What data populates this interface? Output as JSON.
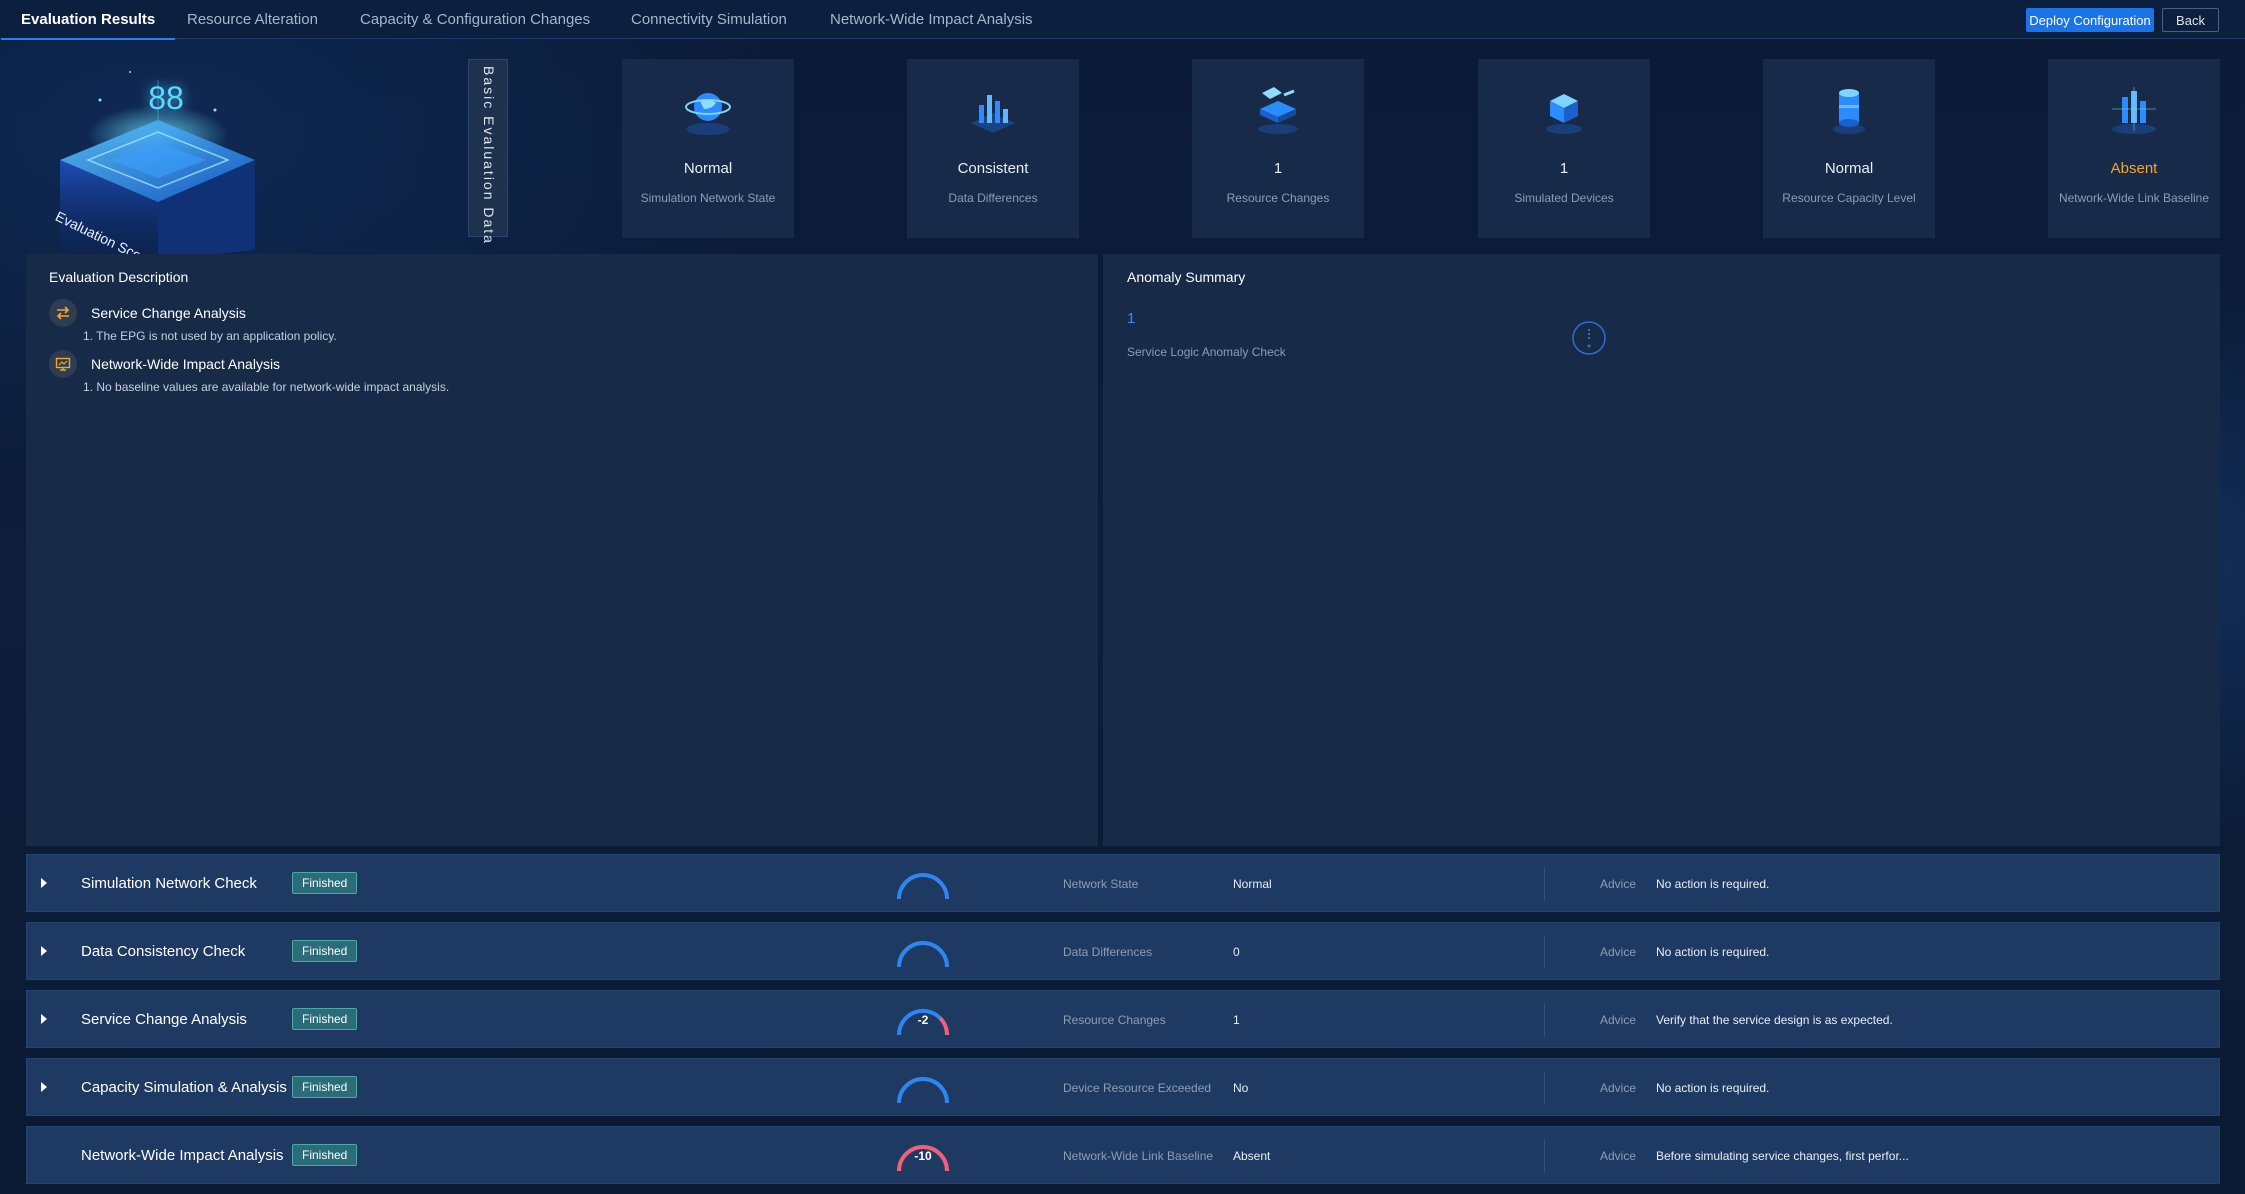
{
  "tabs": [
    {
      "label": "Evaluation Results",
      "active": true
    },
    {
      "label": "Resource Alteration",
      "active": false
    },
    {
      "label": "Capacity & Configuration Changes",
      "active": false
    },
    {
      "label": "Connectivity Simulation",
      "active": false
    },
    {
      "label": "Network-Wide Impact Analysis",
      "active": false
    }
  ],
  "header_buttons": {
    "deploy": "Deploy Configuration",
    "back": "Back"
  },
  "score": {
    "value": "88",
    "label": "Evaluation Score"
  },
  "basic_data_label": "Basic Evaluation Data",
  "metrics": [
    {
      "value": "Normal",
      "label": "Simulation Network State",
      "icon": "globe-network-icon"
    },
    {
      "value": "Consistent",
      "label": "Data Differences",
      "icon": "bar-chart-icon"
    },
    {
      "value": "1",
      "label": "Resource Changes",
      "icon": "resource-change-icon"
    },
    {
      "value": "1",
      "label": "Simulated Devices",
      "icon": "device-cube-icon"
    },
    {
      "value": "Normal",
      "label": "Resource Capacity Level",
      "icon": "capacity-cylinder-icon"
    },
    {
      "value": "Absent",
      "label": "Network-Wide Link Baseline",
      "icon": "link-baseline-icon"
    }
  ],
  "evaluation_description": {
    "title": "Evaluation Description",
    "items": [
      {
        "title": "Service Change Analysis",
        "icon": "swap-arrows-icon",
        "lines": [
          "1.   The EPG is not used by an application policy."
        ]
      },
      {
        "title": "Network-Wide Impact Analysis",
        "icon": "monitor-icon",
        "lines": [
          "1.   No baseline values are available for network-wide impact analysis."
        ]
      }
    ]
  },
  "anomaly_summary": {
    "title": "Anomaly Summary",
    "count": "1",
    "label": "Service Logic Anomaly Check",
    "icon": "info-circle-icon"
  },
  "checks": [
    {
      "name": "Simulation Network Check",
      "status": "Finished",
      "score": "",
      "metric_label": "Network State",
      "metric_value": "Normal",
      "advice_label": "Advice",
      "advice": "No action is required.",
      "expandable": true
    },
    {
      "name": "Data Consistency Check",
      "status": "Finished",
      "score": "",
      "metric_label": "Data Differences",
      "metric_value": "0",
      "advice_label": "Advice",
      "advice": "No action is required.",
      "expandable": true
    },
    {
      "name": "Service Change Analysis",
      "status": "Finished",
      "score": "-2",
      "metric_label": "Resource Changes",
      "metric_value": "1",
      "advice_label": "Advice",
      "advice": "Verify that the service design is as expected.",
      "expandable": true
    },
    {
      "name": "Capacity Simulation & Analysis",
      "status": "Finished",
      "score": "",
      "metric_label": "Device Resource Exceeded",
      "metric_value": "No",
      "advice_label": "Advice",
      "advice": "No action is required.",
      "expandable": true
    },
    {
      "name": "Network-Wide Impact Analysis",
      "status": "Finished",
      "score": "-10",
      "metric_label": "Network-Wide Link Baseline",
      "metric_value": "Absent",
      "advice_label": "Advice",
      "advice": "Before simulating service changes, first perfor...",
      "expandable": false
    }
  ],
  "colors": {
    "accent": "#1a73e8",
    "warning": "#f5a623",
    "gauge_ok": "#2f86f0",
    "gauge_bad": "#f0607a",
    "badge": "#2a6c78"
  }
}
